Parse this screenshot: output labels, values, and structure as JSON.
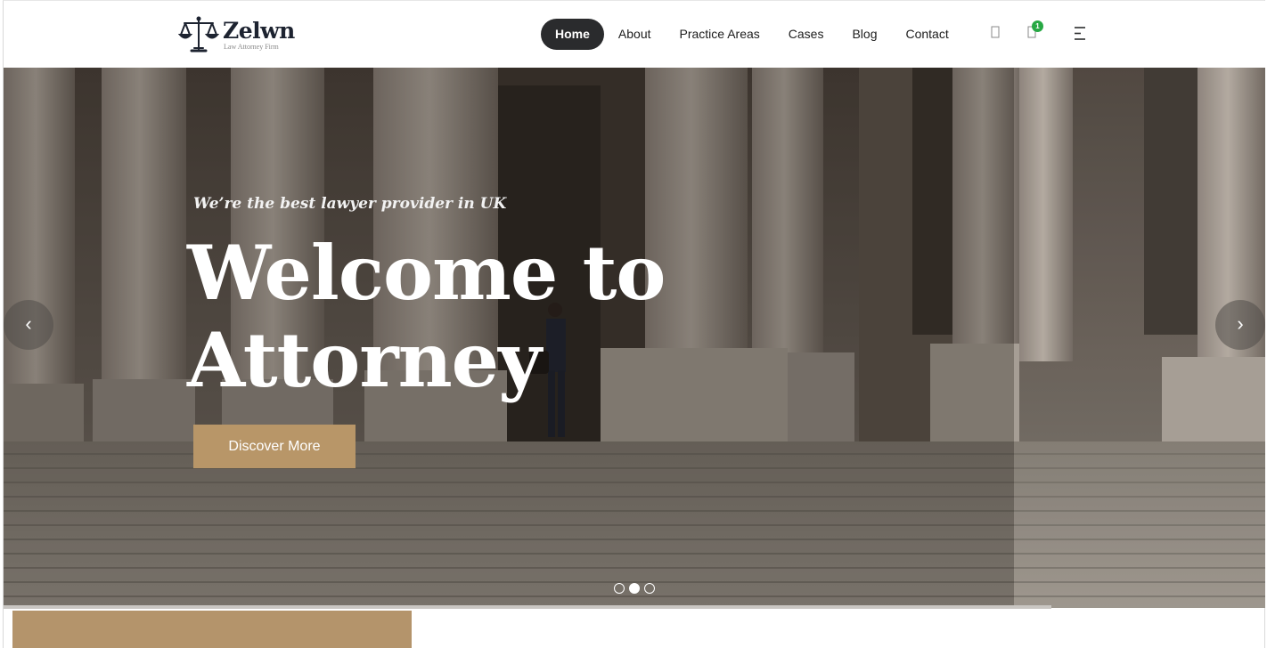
{
  "brand": {
    "name": "Zelwn",
    "tagline": "Law Attorney Firm"
  },
  "nav": {
    "items": [
      {
        "label": "Home",
        "active": true
      },
      {
        "label": "About",
        "active": false
      },
      {
        "label": "Practice Areas",
        "active": false
      },
      {
        "label": "Cases",
        "active": false
      },
      {
        "label": "Blog",
        "active": false
      },
      {
        "label": "Contact",
        "active": false
      }
    ]
  },
  "header_icons": {
    "search": "search-icon",
    "cart": "cart-icon",
    "cart_count": "1",
    "menu": "menu-icon"
  },
  "hero": {
    "subtitle": "We’re the best lawyer provider in UK",
    "title_line1": "Welcome to",
    "title_line2": "Attorney",
    "cta_label": "Discover More",
    "prev_arrow": "‹",
    "next_arrow": "›",
    "slides": 3,
    "active_slide": 2
  },
  "colors": {
    "accent": "#b89668",
    "nav_active_bg": "#2a2b2d",
    "badge": "#27a844"
  }
}
